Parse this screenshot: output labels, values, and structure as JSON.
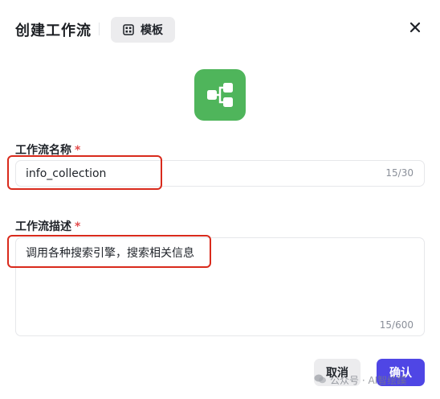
{
  "header": {
    "title": "创建工作流",
    "template_button_label": "模板",
    "template_icon": "grid-icon",
    "close_icon": "close-icon"
  },
  "logo": {
    "icon": "workflow-icon",
    "color": "#4fb55b"
  },
  "form": {
    "name": {
      "label": "工作流名称",
      "required_mark": "*",
      "value": "info_collection",
      "counter": "15/30"
    },
    "description": {
      "label": "工作流描述",
      "required_mark": "*",
      "value": "调用各种搜索引擎，搜索相关信息",
      "counter": "15/600"
    }
  },
  "footer": {
    "cancel_label": "取消",
    "confirm_label": "确认",
    "confirm_color": "#4f46e5"
  },
  "watermark": {
    "text": "公众号 · AI智绘蹊"
  },
  "highlight_color": "#d92a1c"
}
